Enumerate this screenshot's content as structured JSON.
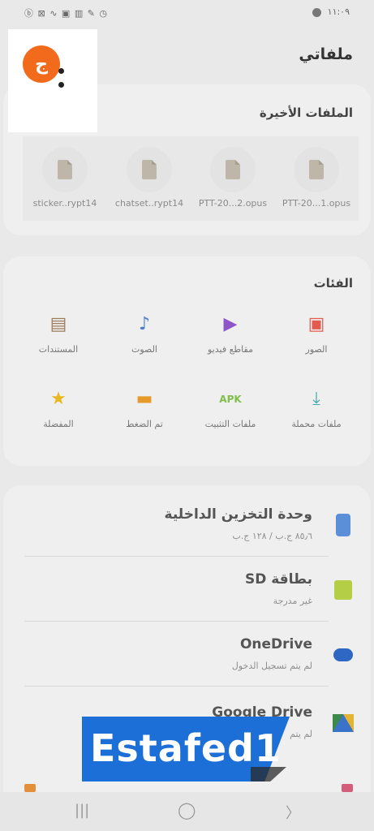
{
  "status": {
    "left": "ⓑ ⊠ ∿ ▣ ▥ ✎ ◷",
    "time": "١١:٠٩"
  },
  "app": {
    "title": "ملفاتي"
  },
  "menu": {
    "avatar_letter": "ج"
  },
  "recent": {
    "title": "الملفات الأخيرة",
    "files": [
      {
        "name": "sticker..rypt14"
      },
      {
        "name": "chatset..rypt14"
      },
      {
        "name": "PTT-20...2.opus"
      },
      {
        "name": "PTT-20...1.opus"
      }
    ]
  },
  "categories": {
    "title": "الفئات",
    "items": [
      {
        "label": "الصور",
        "icon": "image-icon",
        "color": "#e35a4f"
      },
      {
        "label": "مقاطع فيديو",
        "icon": "video-icon",
        "color": "#8e55c7"
      },
      {
        "label": "الصوت",
        "icon": "music-note-icon",
        "color": "#4a7fcf"
      },
      {
        "label": "المستندات",
        "icon": "document-icon",
        "color": "#9c7b5a"
      },
      {
        "label": "ملفات محملة",
        "icon": "download-icon",
        "color": "#46a8a8"
      },
      {
        "label": "ملفات التثبيت",
        "icon": "apk-icon",
        "color": "#7fbe4a"
      },
      {
        "label": "تم الضغط",
        "icon": "folder-zip-icon",
        "color": "#e59a2a"
      },
      {
        "label": "المفضلة",
        "icon": "star-icon",
        "color": "#e8b820"
      }
    ]
  },
  "storage": {
    "items": [
      {
        "title": "وحدة التخزين الداخلية",
        "sub": "٨٥٫٦ ج.ب / ١٢٨ ج.ب",
        "icon": "phone-storage-icon"
      },
      {
        "title": "بطاقة SD",
        "sub": "غير مدرجة",
        "icon": "sd-card-icon"
      },
      {
        "title": "OneDrive",
        "sub": "لم يتم تسجيل الدخول",
        "icon": "onedrive-icon"
      },
      {
        "title": "Google Drive",
        "sub": "لم يتم",
        "icon": "google-drive-icon"
      }
    ]
  },
  "watermark": {
    "text": "Estafed1"
  },
  "nav": {
    "recents": "|||",
    "home": "◯",
    "back": "〉"
  }
}
